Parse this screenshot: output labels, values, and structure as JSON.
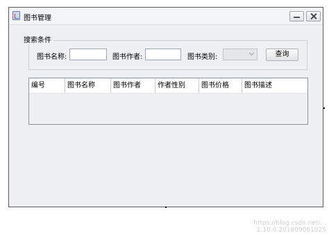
{
  "window": {
    "title": "图书管理"
  },
  "search": {
    "legend": "搜索条件",
    "book_name_label": "图书名称:",
    "book_name_value": "",
    "author_label": "图书作者:",
    "author_value": "",
    "type_label": "图书类别:",
    "type_selected": "",
    "query_button": "查询"
  },
  "table": {
    "columns": [
      "编号",
      "图书名称",
      "图书作者",
      "作者性别",
      "图书价格",
      "图书描述"
    ],
    "rows": []
  },
  "watermark": {
    "line1": "https://blog.csdn.net/...",
    "line2": "1.10.0.201809061025"
  },
  "icons": {
    "app": "java-coffee-icon",
    "minimize": "minimize-icon",
    "close": "close-icon",
    "dropdown": "chevron-down-icon"
  }
}
